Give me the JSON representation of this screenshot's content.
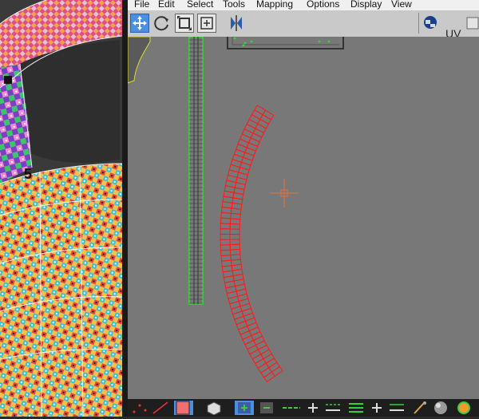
{
  "menu": {
    "items": [
      "File",
      "Edit",
      "Select",
      "Tools",
      "Mapping",
      "Options",
      "Display",
      "View"
    ]
  },
  "toolbar": {
    "tools": [
      "move-tool",
      "rotate-tool",
      "scale-tool",
      "freeform-tool",
      "mirror-tool"
    ],
    "uv_label": "UV"
  },
  "canvas": {
    "background": "#787878",
    "uv_shell_color": "#ff1a1a",
    "strip_color": "#33dd33",
    "gizmo_color": "#e8703a"
  },
  "viewport": {
    "checker_colors": [
      "#e8453c",
      "#f5c242",
      "#3ec1d3",
      "#7a3fc4",
      "#3fc46a",
      "#f28ad0"
    ],
    "face_number": "5"
  }
}
